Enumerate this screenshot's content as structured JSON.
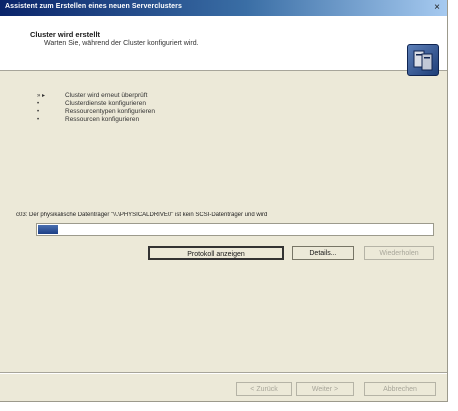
{
  "window": {
    "title": "Assistent zum Erstellen eines neuen Serverclusters",
    "close_glyph": "×"
  },
  "header": {
    "title": "Cluster wird erstellt",
    "subtitle": "Warten Sie, während der Cluster konfiguriert wird."
  },
  "steps": [
    {
      "mark": "»  ▸",
      "label": "Cluster wird erneut überprüft"
    },
    {
      "mark": "•",
      "label": "Clusterdienste konfigurieren"
    },
    {
      "mark": "•",
      "label": "Ressourcentypen konfigurieren"
    },
    {
      "mark": "•",
      "label": "Ressourcen konfigurieren"
    }
  ],
  "status": {
    "text": "c03: Der physikalische Datenträger \"\\\\.\\PHYSICALDRIVE0\" ist kein SCSI-Datenträger und wird",
    "progress": 0.05
  },
  "buttons": {
    "log": "Protokoll anzeigen",
    "details": "Details...",
    "retry": "Wiederholen",
    "back": "< Zurück",
    "next": "Weiter >",
    "cancel": "Abbrechen"
  },
  "colors": {
    "accent": "#1d3f86",
    "dialog_bg": "#ece9d8"
  }
}
